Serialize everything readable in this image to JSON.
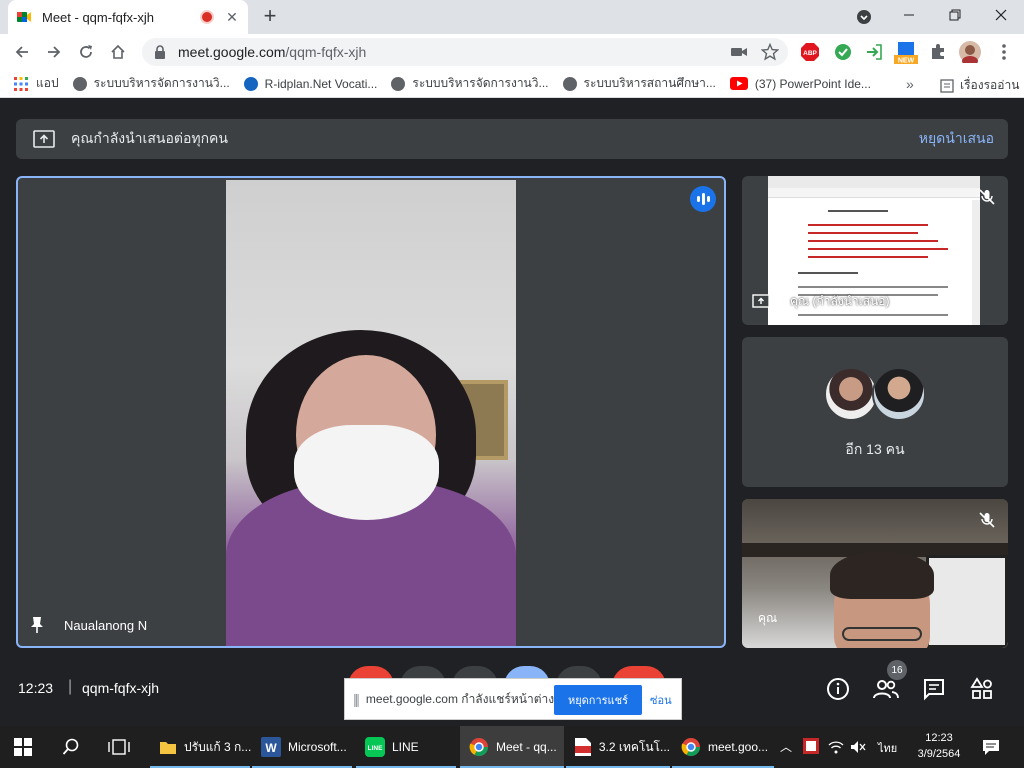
{
  "browser": {
    "tab_title": "Meet - qqm-fqfx-xjh",
    "url_host": "meet.google.com",
    "url_path": "/qqm-fqfx-xjh",
    "bookmarks": [
      {
        "label": "แอป",
        "icon": "apps-grid-icon"
      },
      {
        "label": "ระบบบริหารจัดการงานวิ...",
        "icon": "globe-icon"
      },
      {
        "label": "R-idplan.Net Vocati...",
        "icon": "site-logo-icon"
      },
      {
        "label": "ระบบบริหารจัดการงานวิ...",
        "icon": "globe-icon"
      },
      {
        "label": "ระบบบริหารสถานศึกษา...",
        "icon": "globe-icon"
      },
      {
        "label": "(37) PowerPoint Ide...",
        "icon": "youtube-icon"
      }
    ],
    "reading_list": "เรื่องรออ่าน",
    "extension_new_badge": "NEW",
    "adblock_label": "ABP"
  },
  "meet": {
    "presenting_text": "คุณกำลังนำเสนอต่อทุกคน",
    "stop_presenting": "หยุดนำเสนอ",
    "main_participant": "Naualanong N",
    "presenter_tile_name": "คุณ (กำลังนำเสนอ)",
    "more_people": "อีก 13 คน",
    "self_tile_name": "คุณ",
    "time": "12:23",
    "separator": "|",
    "meeting_code": "qqm-fqfx-xjh",
    "participant_count": "16",
    "share_banner": {
      "message": "meet.google.com กำลังแชร์หน้าต่าง",
      "stop_label": "หยุดการแชร์",
      "hide_label": "ซ่อน"
    }
  },
  "taskbar": {
    "apps": [
      {
        "label": "ปรับแก้ 3 ก...",
        "icon": "folder-icon"
      },
      {
        "label": "Microsoft...",
        "icon": "word-icon"
      },
      {
        "label": "LINE",
        "icon": "line-icon"
      },
      {
        "label": "Meet - qq...",
        "icon": "chrome-icon"
      },
      {
        "label": "3.2 เทคโนโ...",
        "icon": "pdf-icon"
      },
      {
        "label": "meet.goo...",
        "icon": "chrome-icon"
      }
    ],
    "language": "ไทย",
    "clock_time": "12:23",
    "clock_date": "3/9/2564"
  }
}
